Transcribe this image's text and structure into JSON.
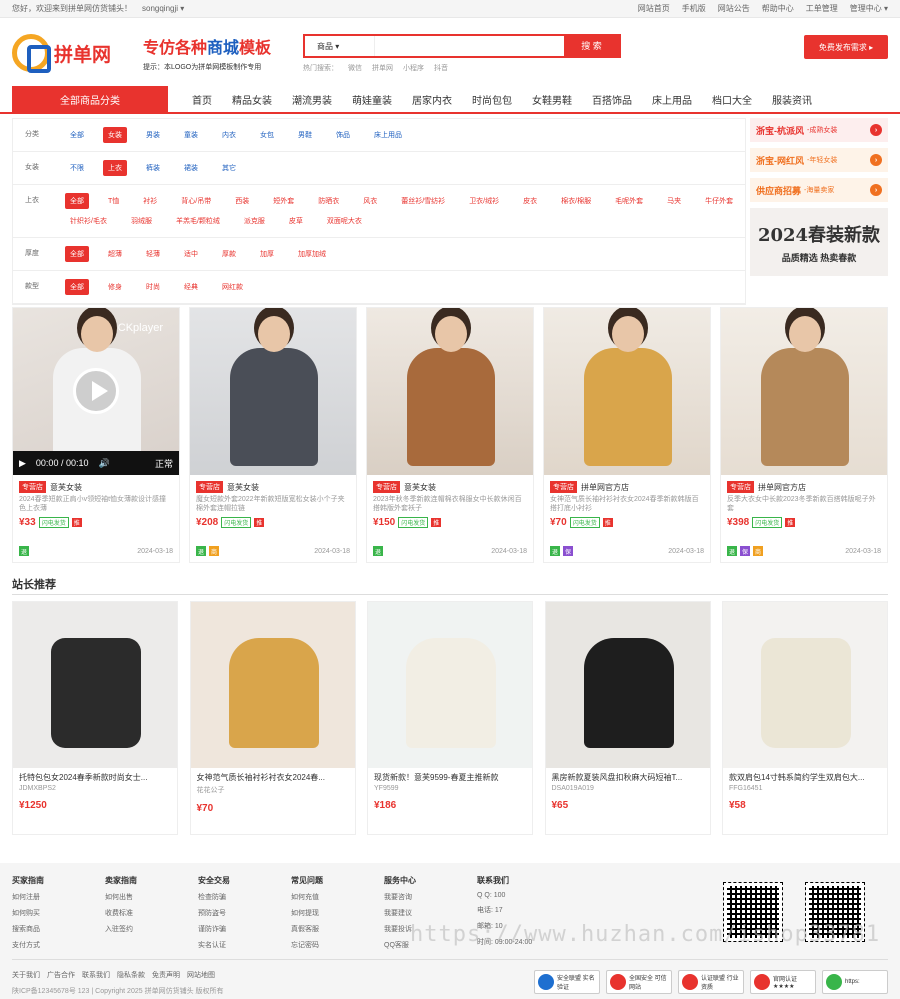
{
  "topbar": {
    "welcome": "您好，欢迎来到拼单网仿货铺头！",
    "user": "songqingji ▾",
    "links": [
      "网站首页",
      "手机版",
      "网站公告",
      "帮助中心",
      "工单管理",
      "管理中心 ▾"
    ]
  },
  "header": {
    "logo_text": "拼单网",
    "slogan_red": "专仿各种",
    "slogan_blue": "商城",
    "slogan_tail": "模板",
    "slogan_sub": "提示：本LOGO为拼单网模板制作专用",
    "search_select": "商品 ▾",
    "search_placeholder": "",
    "search_button": "搜 索",
    "hot_label": "热门搜索：",
    "hot_words": [
      "微信",
      "拼单网",
      "小程序",
      "抖音"
    ],
    "publish_button": "免费发布需求 ▸"
  },
  "nav": {
    "all_label": "全部商品分类",
    "items": [
      "首页",
      "精品女装",
      "潮流男装",
      "萌娃童装",
      "居家内衣",
      "时尚包包",
      "女鞋男鞋",
      "百搭饰品",
      "床上用品",
      "档口大全",
      "服装资讯"
    ]
  },
  "filters": [
    {
      "label": "分类",
      "values": [
        "全部",
        "女装",
        "男装",
        "童装",
        "内衣",
        "女包",
        "男鞋",
        "饰品",
        "床上用品"
      ],
      "on": 1
    },
    {
      "label": "女装",
      "values": [
        "不限",
        "上衣",
        "裤装",
        "裙装",
        "其它"
      ],
      "on": 1
    },
    {
      "label": "上衣",
      "values": [
        "全部",
        "T恤",
        "衬衫",
        "背心/吊带",
        "西装",
        "短外套",
        "防晒衣",
        "风衣",
        "蕾丝衫/雪纺衫",
        "卫衣/绒衫",
        "皮衣",
        "棉衣/棉服",
        "毛呢外套",
        "马夹",
        "牛仔外套",
        "针织衫/毛衣",
        "羽绒服",
        "羊羔毛/颗粒绒",
        "派克服",
        "皮草",
        "双面呢大衣"
      ],
      "on": 0
    },
    {
      "label": "厚度",
      "values": [
        "全部",
        "超薄",
        "轻薄",
        "适中",
        "厚款",
        "加厚",
        "加厚加绒"
      ],
      "on": 0
    },
    {
      "label": "款型",
      "values": [
        "全部",
        "修身",
        "时尚",
        "经典",
        "网红款"
      ],
      "on": 0
    }
  ],
  "ads": [
    {
      "title": "浙宝-杭派风",
      "sub": "-成熟女装",
      "arrow": "›"
    },
    {
      "title": "浙宝-网红风",
      "sub": "-年轻女装",
      "arrow": "›"
    },
    {
      "title": "供应商招募",
      "sub": "-海量卖家",
      "arrow": "›"
    }
  ],
  "promo": {
    "title": "2024春装新款",
    "sub": "品质精选 热卖春款"
  },
  "video": {
    "watermark": "CKplayer",
    "time": "00:00 / 00:10",
    "mode": "正常"
  },
  "products": [
    {
      "tag": "专营店",
      "shop": "意芙女装",
      "desc": "2024春季短款正肩小v领短袖t恤女薄款设计感撞色上衣薄",
      "price": "¥33",
      "ship": "闪电发货",
      "dan": "推",
      "icons": [
        "退"
      ],
      "date": "2024-03-18"
    },
    {
      "tag": "专营店",
      "shop": "意芙女装",
      "desc": "魔女短款外套2022年新款短版宽松女装小个子夹棉外套连帽拉链",
      "price": "¥208",
      "ship": "闪电发货",
      "dan": "推",
      "icons": [
        "退",
        "商"
      ],
      "date": "2024-03-18"
    },
    {
      "tag": "专营店",
      "shop": "意芙女装",
      "desc": "2023年秋冬季新款连帽棉衣棉服女中长款休闲百搭韩版外套袄子",
      "price": "¥150",
      "ship": "闪电发货",
      "dan": "推",
      "icons": [
        "退"
      ],
      "date": "2024-03-18"
    },
    {
      "tag": "专营店",
      "shop": "拼单网官方店",
      "desc": "女神范气质长袖衬衫衬衣女2024春季新款韩版百搭打底小衬衫",
      "price": "¥70",
      "ship": "闪电发货",
      "dan": "推",
      "icons": [
        "退",
        "保"
      ],
      "date": "2024-03-18"
    },
    {
      "tag": "专营店",
      "shop": "拼单网官方店",
      "desc": "反季大衣女中长款2023冬季新款百搭韩版呢子外套",
      "price": "¥398",
      "ship": "闪电发货",
      "dan": "推",
      "icons": [
        "退",
        "保",
        "商"
      ],
      "date": "2024-03-18"
    }
  ],
  "section_title": "站长推荐",
  "recommend": [
    {
      "name": "托特包包女2024春季新款时尚女士...",
      "sku": "JDMXBPS2",
      "price": "¥1250"
    },
    {
      "name": "女神范气质长袖衬衫衬衣女2024春...",
      "sku": "花花公子",
      "price": "¥70"
    },
    {
      "name": "现货新款！意芙9599-春夏主推新款",
      "sku": "YF9599",
      "price": "¥186"
    },
    {
      "name": "黑房新款夏装风盘扣秋麻大码短袖T...",
      "sku": "DSA019A019",
      "price": "¥65"
    },
    {
      "name": "款双肩包14寸韩系简约学生双肩包大...",
      "sku": "FFG16451",
      "price": "¥58"
    }
  ],
  "footer": {
    "cols": [
      {
        "title": "买家指南",
        "links": [
          "如何注册",
          "如何购买",
          "搜索商品",
          "支付方式"
        ]
      },
      {
        "title": "卖家指南",
        "links": [
          "如何出售",
          "收费标准",
          "入驻签约"
        ]
      },
      {
        "title": "安全交易",
        "links": [
          "检查防骗",
          "预防盗号",
          "谨防诈骗",
          "实名认证"
        ]
      },
      {
        "title": "常见问题",
        "links": [
          "如何充值",
          "如何提现",
          "真假客服",
          "忘记密码"
        ]
      },
      {
        "title": "服务中心",
        "links": [
          "我要咨询",
          "我要建议",
          "我要投诉",
          "QQ客服"
        ]
      }
    ],
    "contact_title": "联系我们",
    "contact": [
      "Q Q: 100",
      "电话: 17",
      "邮箱: 10",
      "时间: 09:00-24:00"
    ],
    "links": [
      "关于我们",
      "广告合作",
      "联系我们",
      "隐私条款",
      "免责声明",
      "网站地图"
    ],
    "copyright": "陕ICP备12345678号 123  |  Copyright 2025 拼单网仿货铺头 版权所有",
    "badges": [
      "安全联盟 实名验证",
      "全国安全 可信网站",
      "认证联盟 行业资质",
      "官网认证 ★★★★",
      "https:"
    ]
  },
  "watermark": "https://www.huzhan.com/ishop33781",
  "colors": {
    "accent": "#e8332e",
    "link": "#1e5fbf",
    "green": "#39b54a"
  }
}
